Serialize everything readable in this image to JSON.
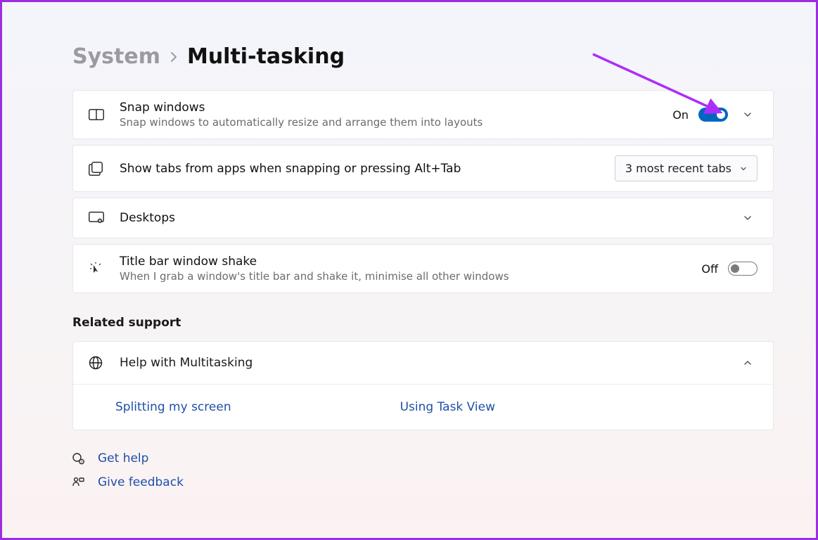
{
  "breadcrumb": {
    "parent": "System",
    "current": "Multi-tasking"
  },
  "cards": {
    "snap": {
      "title": "Snap windows",
      "subtitle": "Snap windows to automatically resize and arrange them into layouts",
      "state": "On"
    },
    "showTabs": {
      "title": "Show tabs from apps when snapping or pressing Alt+Tab",
      "dropdown": "3 most recent tabs"
    },
    "desktops": {
      "title": "Desktops"
    },
    "shake": {
      "title": "Title bar window shake",
      "subtitle": "When I grab a window's title bar and shake it, minimise all other windows",
      "state": "Off"
    }
  },
  "related": {
    "heading": "Related support",
    "help_title": "Help with Multitasking",
    "links": {
      "split": "Splitting my screen",
      "taskview": "Using Task View"
    }
  },
  "footer": {
    "get_help": "Get help",
    "give_feedback": "Give feedback"
  },
  "colors": {
    "accent": "#0067c0",
    "link": "#1e4fa8",
    "annotation": "#ad2dfb"
  }
}
